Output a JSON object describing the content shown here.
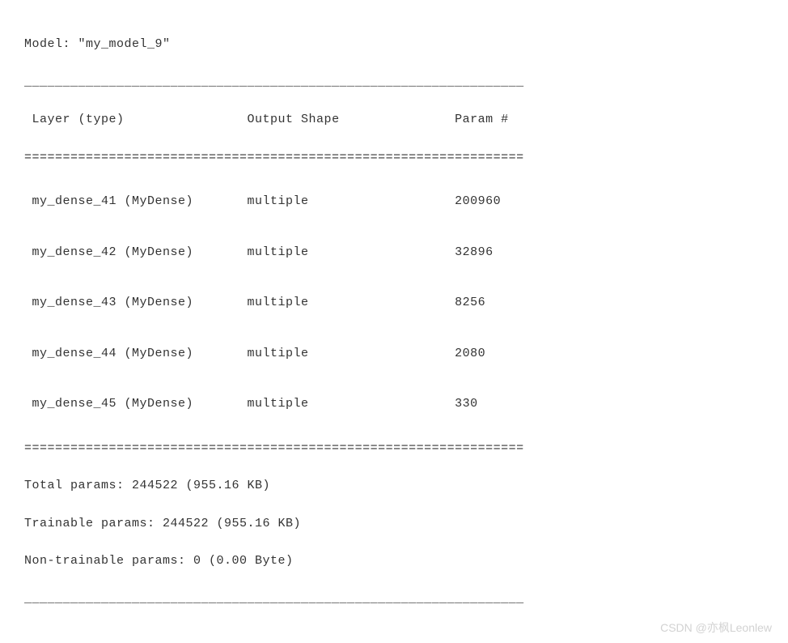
{
  "model": {
    "label": "Model:",
    "name": "\"my_model_9\""
  },
  "separator_single": "_________________________________________________________________",
  "separator_double": "=================================================================",
  "headers": {
    "layer": " Layer (type)",
    "output": "Output Shape",
    "param": "Param #"
  },
  "layers": [
    {
      "type": " my_dense_41 (MyDense)",
      "shape": "multiple",
      "param": "200960"
    },
    {
      "type": " my_dense_42 (MyDense)",
      "shape": "multiple",
      "param": "32896"
    },
    {
      "type": " my_dense_43 (MyDense)",
      "shape": "multiple",
      "param": "8256"
    },
    {
      "type": " my_dense_44 (MyDense)",
      "shape": "multiple",
      "param": "2080"
    },
    {
      "type": " my_dense_45 (MyDense)",
      "shape": "multiple",
      "param": "330"
    }
  ],
  "stats": {
    "total": "Total params: 244522 (955.16 KB)",
    "trainable": "Trainable params: 244522 (955.16 KB)",
    "non_trainable": "Non-trainable params: 0 (0.00 Byte)"
  },
  "watermark": "CSDN @亦枫Leonlew",
  "chart_data": {
    "type": "table",
    "title": "Model Summary: my_model_9",
    "columns": [
      "Layer (type)",
      "Output Shape",
      "Param #"
    ],
    "rows": [
      [
        "my_dense_41 (MyDense)",
        "multiple",
        200960
      ],
      [
        "my_dense_42 (MyDense)",
        "multiple",
        32896
      ],
      [
        "my_dense_43 (MyDense)",
        "multiple",
        8256
      ],
      [
        "my_dense_44 (MyDense)",
        "multiple",
        2080
      ],
      [
        "my_dense_45 (MyDense)",
        "multiple",
        330
      ]
    ],
    "totals": {
      "total_params": 244522,
      "total_params_size": "955.16 KB",
      "trainable_params": 244522,
      "trainable_params_size": "955.16 KB",
      "non_trainable_params": 0,
      "non_trainable_params_size": "0.00 Byte"
    }
  }
}
